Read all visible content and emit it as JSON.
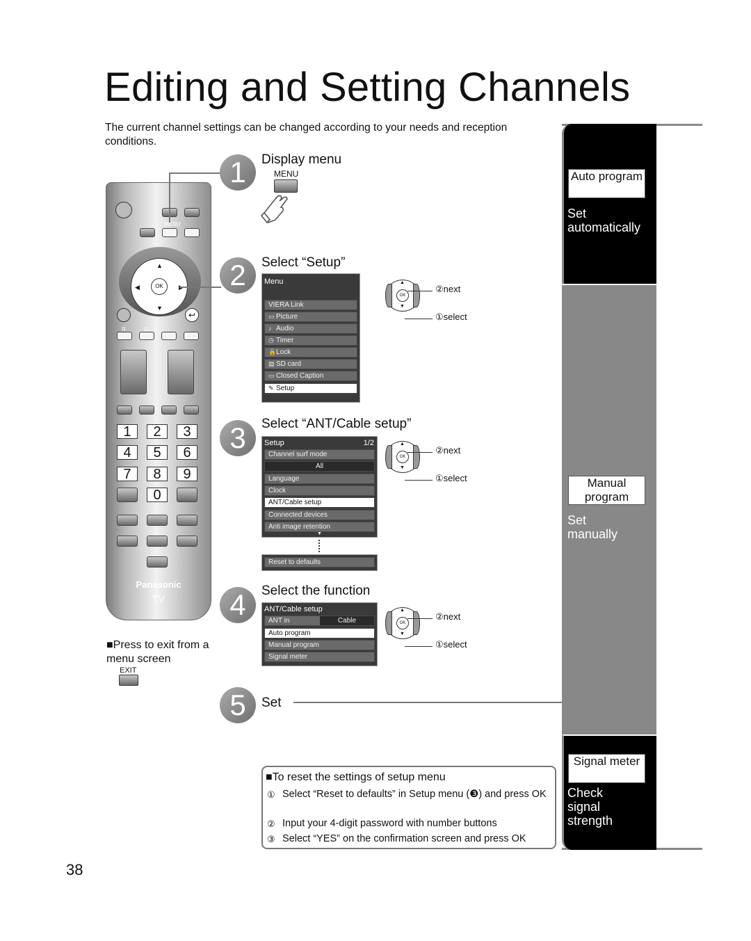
{
  "page": {
    "title": "Editing and Setting Channels",
    "intro": "The current channel settings can be changed according to your needs and reception conditions.",
    "page_number": "38"
  },
  "remote": {
    "brand": "Panasonic",
    "model": "TV",
    "labels": {
      "menu": "MENU",
      "ok": "OK",
      "red": "R",
      "green": "G"
    },
    "number_keys": [
      "1",
      "2",
      "3",
      "4",
      "5",
      "6",
      "7",
      "8",
      "9",
      "0"
    ]
  },
  "exit_note": {
    "text": "Press to exit from a menu screen",
    "button_label": "EXIT"
  },
  "steps": [
    {
      "number": "1",
      "title": "Display menu",
      "button_label": "MENU"
    },
    {
      "number": "2",
      "title": "Select “Setup”",
      "osd": {
        "header": "Menu",
        "items": [
          {
            "icon": "",
            "label": "VIERA Link",
            "selected": false
          },
          {
            "icon": "▭",
            "label": "Picture",
            "selected": false
          },
          {
            "icon": "♪",
            "label": "Audio",
            "selected": false
          },
          {
            "icon": "◷",
            "label": "Timer",
            "selected": false
          },
          {
            "icon": "🔒",
            "label": "Lock",
            "selected": false
          },
          {
            "icon": "▤",
            "label": "SD card",
            "selected": false
          },
          {
            "icon": "▭",
            "label": "Closed Caption",
            "selected": false
          },
          {
            "icon": "✎",
            "label": "Setup",
            "selected": true
          }
        ]
      },
      "nav": {
        "next": "②next",
        "select": "①select"
      }
    },
    {
      "number": "3",
      "title": "Select “ANT/Cable setup”",
      "osd": {
        "header": "Setup",
        "page": "1/2",
        "items": [
          {
            "label": "Channel surf mode",
            "selected": false
          },
          {
            "label": "All",
            "value": true
          },
          {
            "label": "Language",
            "selected": false
          },
          {
            "label": "Clock",
            "selected": false
          },
          {
            "label": "ANT/Cable setup",
            "selected": true
          },
          {
            "label": "Connected devices",
            "selected": false
          },
          {
            "label": "Anti image retention",
            "selected": false
          }
        ],
        "more_indicator": "▼",
        "footer_item": "Reset to defaults"
      },
      "nav": {
        "next": "②next",
        "select": "①select"
      }
    },
    {
      "number": "4",
      "title": "Select the function",
      "osd": {
        "header": "ANT/Cable setup",
        "ant_in_label": "ANT in",
        "ant_in_value": "Cable",
        "items": [
          {
            "label": "Auto program",
            "selected": true
          },
          {
            "label": "Manual program",
            "selected": false
          },
          {
            "label": "Signal meter",
            "selected": false
          }
        ]
      },
      "nav": {
        "next": "②next",
        "select": "①select"
      }
    },
    {
      "number": "5",
      "title": "Set"
    }
  ],
  "reset_box": {
    "title": "To reset the settings of setup menu",
    "steps": [
      {
        "num": "①",
        "text": "Select “Reset to defaults” in Setup menu (❸) and press OK"
      },
      {
        "num": "②",
        "text": "Input your 4-digit password with number buttons"
      },
      {
        "num": "③",
        "text": "Select “YES” on the confirmation screen and press OK"
      }
    ]
  },
  "sidebar": {
    "sections": [
      {
        "label": "Auto program",
        "description": "Set automatically",
        "bg": "#000000"
      },
      {
        "label": "Manual program",
        "description": "Set manually",
        "bg": "#888888"
      },
      {
        "label": "Signal meter",
        "description": "Check signal strength",
        "bg": "#000000"
      }
    ]
  }
}
